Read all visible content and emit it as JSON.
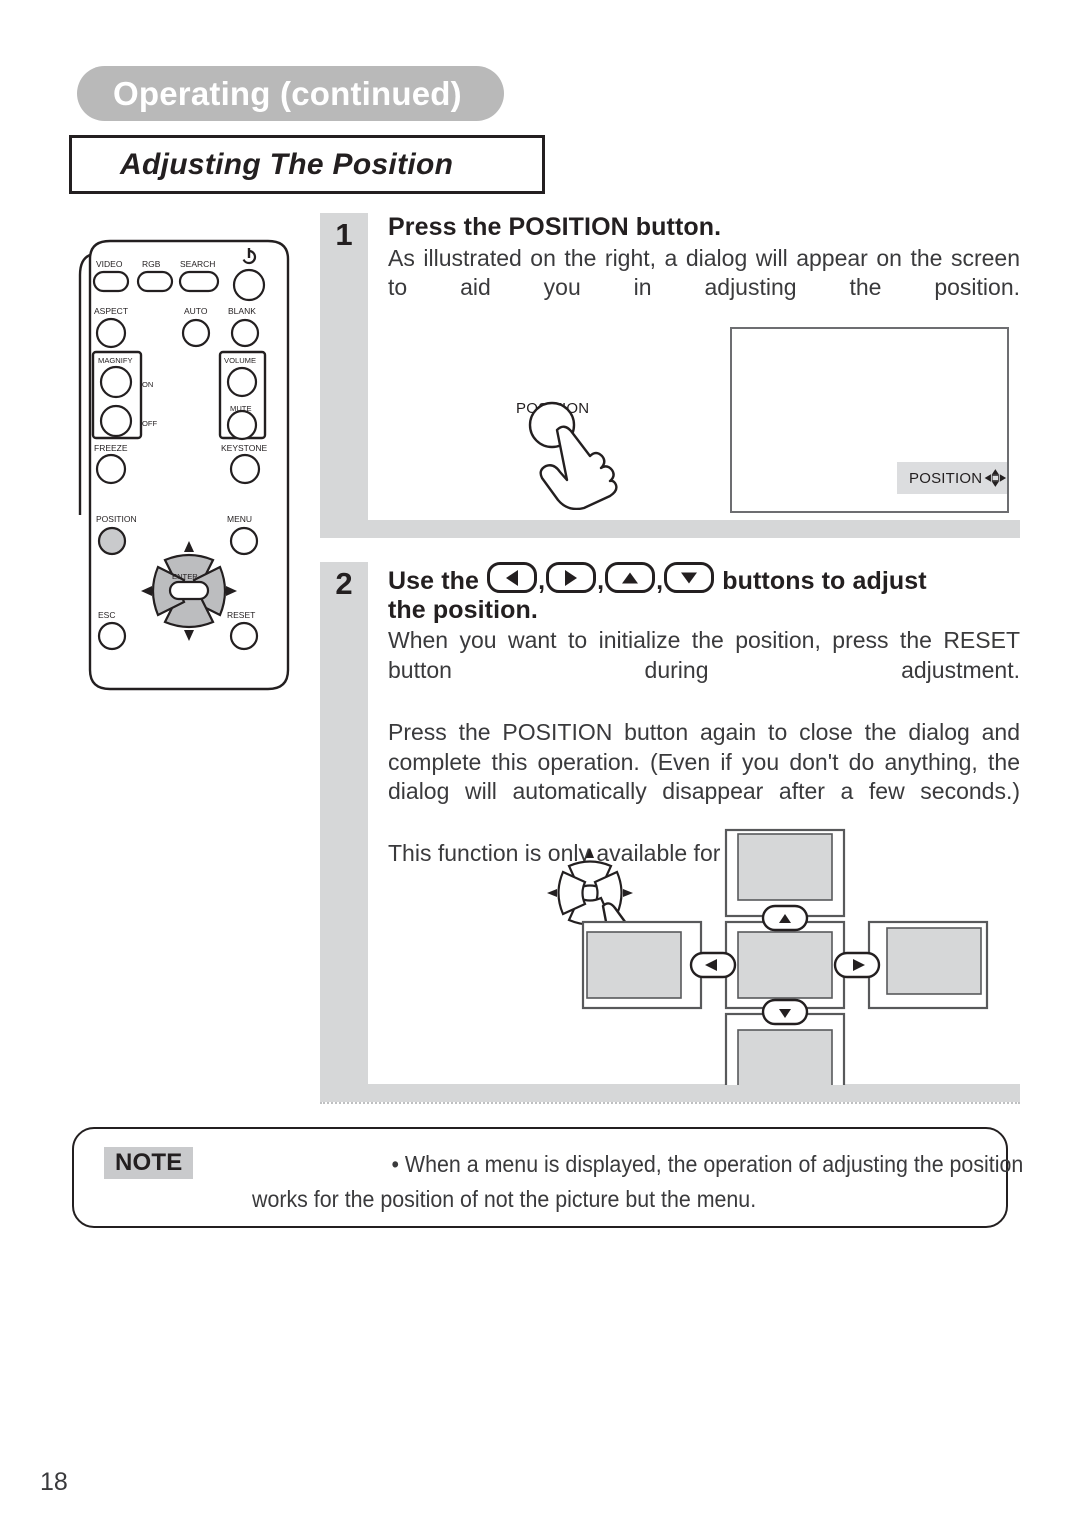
{
  "header": {
    "chapter_tab": "Operating (continued)",
    "section_title": "Adjusting The Position"
  },
  "remote": {
    "name": "remote-control",
    "buttons": [
      {
        "label": "VIDEO"
      },
      {
        "label": "RGB"
      },
      {
        "label": "SEARCH"
      },
      {
        "label": "power-icon"
      },
      {
        "label": "ASPECT"
      },
      {
        "label": "AUTO"
      },
      {
        "label": "BLANK"
      },
      {
        "label": "MAGNIFY"
      },
      {
        "label": "ON"
      },
      {
        "label": "OFF"
      },
      {
        "label": "VOLUME"
      },
      {
        "label": "MUTE"
      },
      {
        "label": "FREEZE"
      },
      {
        "label": "KEYSTONE"
      },
      {
        "label": "POSITION"
      },
      {
        "label": "MENU"
      },
      {
        "label": "ENTER"
      },
      {
        "label": "ESC"
      },
      {
        "label": "RESET"
      }
    ],
    "video": "VIDEO",
    "rgb": "RGB",
    "search": "SEARCH",
    "aspect": "ASPECT",
    "auto": "AUTO",
    "blank": "BLANK",
    "magnify": "MAGNIFY",
    "on": "ON",
    "off": "OFF",
    "volume": "VOLUME",
    "mute": "MUTE",
    "freeze": "FREEZE",
    "keystone": "KEYSTONE",
    "position": "POSITION",
    "menu": "MENU",
    "enter": "ENTER",
    "esc": "ESC",
    "reset": "RESET"
  },
  "steps": [
    {
      "number": "1",
      "title": "Press the POSITION button.",
      "text": "As illustrated on the right, a dialog will appear on the screen to aid you in adjusting the position."
    },
    {
      "number": "2",
      "title_before": "Use the",
      "title_after": "buttons to adjust",
      "title_line2": "the position.",
      "text1": "When you want to initialize the position, press the RESET button during adjustment.",
      "text2": "Press the POSITION button again to close the dialog and complete this operation.  (Even if you don't do anything, the dialog will automatically disappear after a few seconds.)",
      "text3": "This function is only available for RGB input."
    }
  ],
  "illustrations": {
    "press_button_label": "POSITION",
    "osd_dialog_label": "POSITION"
  },
  "note": {
    "badge": "NOTE",
    "text": "• When a menu is displayed, the operation of adjusting the position works for the position of not the picture but the menu."
  },
  "footer": {
    "page_number": "18"
  },
  "colors": {
    "tab_gray": "#b9b9b9",
    "step_gray": "#d6d7d8",
    "dialog_gray": "#dcdddf",
    "ink": "#231f20",
    "body_text": "#3a3a3c"
  }
}
